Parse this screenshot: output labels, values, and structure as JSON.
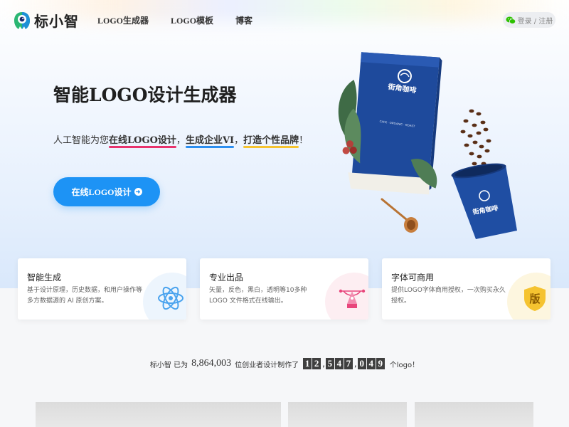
{
  "header": {
    "brand": "标小智",
    "nav": [
      "LOGO生成器",
      "LOGO模板",
      "博客"
    ],
    "login_label": "登录 / 注册"
  },
  "hero": {
    "title": "智能LOGO设计生成器",
    "subtitle": {
      "part1": "人工智能为您",
      "hl1": "在线LOGO设计",
      "sep1": "，",
      "hl2": "生成企业VI",
      "sep2": "，",
      "hl3": "打造个性品牌",
      "end": "！"
    },
    "cta_label": "在线LOGO设计",
    "mockup": {
      "bag_brand": "街角咖啡",
      "cup_brand": "街角咖啡",
      "bag_line": "CAFE · ORGANIC · ROAST"
    }
  },
  "features": [
    {
      "title": "智能生成",
      "desc": "基于设计原理，历史数据，和用户操作等多方数据源的 AI 原创方案。",
      "icon": "atom-icon",
      "circle": "#edf5fd",
      "color": "#4aa3ee"
    },
    {
      "title": "专业出品",
      "desc": "矢量，反色，黑白，透明等10多种 LOGO 文件格式在线输出。",
      "icon": "pen-tool-icon",
      "circle": "#fdeef2",
      "color": "#e8467c"
    },
    {
      "title": "字体可商用",
      "desc": "提供LOGO字体商用授权，一次购买永久授权。",
      "icon": "shield-icon",
      "circle": "#fdf6df",
      "color": "#f5c330",
      "badge": "版"
    }
  ],
  "stats": {
    "prefix": "标小智 已为",
    "users": "8,864,003",
    "middle": "位创业者设计制作了",
    "d1": [
      "1",
      "2"
    ],
    "d2": [
      "5",
      "4",
      "7"
    ],
    "d3": [
      "0",
      "4",
      "9"
    ],
    "suffix": "个logo！"
  },
  "colors": {
    "primary": "#1d93f5",
    "accent_pink": "#e8336d",
    "accent_yellow": "#f5c330"
  }
}
